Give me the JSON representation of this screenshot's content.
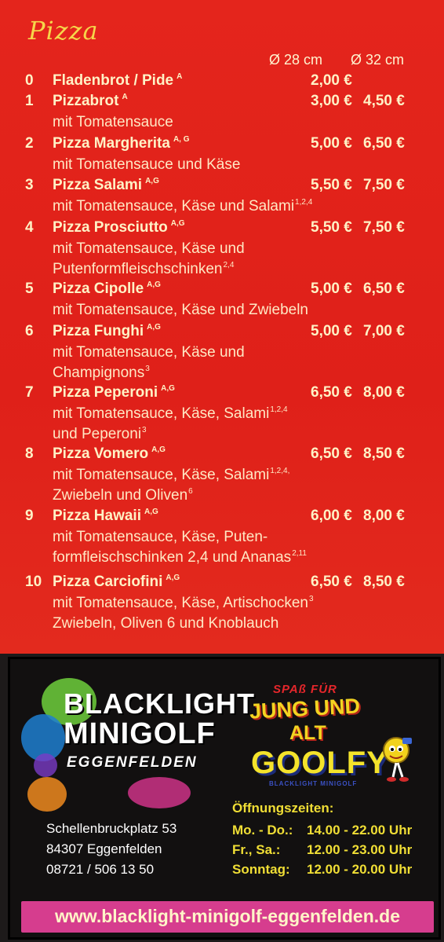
{
  "section_title": "Pizza",
  "sizes": {
    "small": "Ø 28 cm",
    "large": "Ø 32 cm"
  },
  "items": [
    {
      "num": "0",
      "name": "Fladenbrot / Pide",
      "sup": "A",
      "price_28": "2,00 €",
      "price_32": "",
      "desc": []
    },
    {
      "num": "1",
      "name": "Pizzabrot",
      "sup": "A",
      "price_28": "3,00 €",
      "price_32": "4,50 €",
      "desc": [
        {
          "text": "mit Tomatensauce",
          "sup": ""
        }
      ]
    },
    {
      "num": "2",
      "name": "Pizza Margherita",
      "sup": "A, G",
      "price_28": "5,00 €",
      "price_32": "6,50 €",
      "desc": [
        {
          "text": "mit Tomatensauce und Käse",
          "sup": ""
        }
      ]
    },
    {
      "num": "3",
      "name": "Pizza Salami",
      "sup": "A,G",
      "price_28": "5,50 €",
      "price_32": "7,50 €",
      "desc": [
        {
          "text": "mit Tomatensauce, Käse und Salami",
          "sup": "1,2,4"
        }
      ]
    },
    {
      "num": "4",
      "name": "Pizza Prosciutto",
      "sup": "A,G",
      "price_28": "5,50 €",
      "price_32": "7,50 €",
      "desc": [
        {
          "text": "mit Tomatensauce, Käse und",
          "sup": ""
        },
        {
          "text": "Putenformfleischschinken",
          "sup": "2,4"
        }
      ]
    },
    {
      "num": "5",
      "name": "Pizza Cipolle",
      "sup": "A,G",
      "price_28": "5,00 €",
      "price_32": "6,50 €",
      "desc": [
        {
          "text": "mit Tomatensauce, Käse und Zwiebeln",
          "sup": ""
        }
      ]
    },
    {
      "num": "6",
      "name": "Pizza Funghi",
      "sup": "A,G",
      "price_28": "5,00 €",
      "price_32": "7,00 €",
      "desc": [
        {
          "text": "mit Tomatensauce, Käse und",
          "sup": ""
        },
        {
          "text": "Champignons",
          "sup": "3"
        }
      ]
    },
    {
      "num": "7",
      "name": "Pizza Peperoni",
      "sup": "A,G",
      "price_28": "6,50 €",
      "price_32": "8,00 €",
      "desc": [
        {
          "text": "mit Tomatensauce, Käse, Salami",
          "sup": "1,2,4"
        },
        {
          "text": "und Peperoni",
          "sup": "3"
        }
      ]
    },
    {
      "num": "8",
      "name": "Pizza Vomero",
      "sup": "A,G",
      "price_28": "6,50 €",
      "price_32": "8,50 €",
      "desc": [
        {
          "text": "mit Tomatensauce, Käse, Salami",
          "sup": "1,2,4,"
        },
        {
          "text": "Zwiebeln und Oliven",
          "sup": "6"
        }
      ]
    },
    {
      "num": "9",
      "name": "Pizza Hawaii",
      "sup": "A,G",
      "price_28": "6,00 €",
      "price_32": "8,00 €",
      "desc": [
        {
          "text": "mit Tomatensauce, Käse, Puten-",
          "sup": ""
        },
        {
          "text": "formfleischschinken 2,4 und Ananas",
          "sup": "2,11"
        }
      ]
    },
    {
      "num": "10",
      "name": "Pizza Carciofini",
      "sup": "A,G",
      "price_28": "6,50 €",
      "price_32": "8,50 €",
      "desc": [
        {
          "text": "mit Tomatensauce, Käse, Artischocken",
          "sup": "3"
        },
        {
          "text": "Zwiebeln, Oliven 6 und Knoblauch",
          "sup": ""
        }
      ]
    }
  ],
  "ad": {
    "logo_line1": "BLACKLIGHT",
    "logo_line2": "MINIGOLF",
    "logo_line3": "EGGENFELDEN",
    "slogan_1": "SPAß FÜR",
    "slogan_2": "JUNG UND",
    "slogan_3": "ALT",
    "mascot_name": "GOOLFY",
    "mascot_sub": "BLACKLIGHT MINIGOLF",
    "address": [
      "Schellenbruckplatz 53",
      "84307 Eggenfelden",
      "08721 / 506 13 50"
    ],
    "hours_title": "Öffnungszeiten:",
    "hours": [
      {
        "day": "Mo. - Do.:",
        "time": "14.00 - 22.00 Uhr"
      },
      {
        "day": "Fr., Sa.:",
        "time": "12.00 - 23.00 Uhr"
      },
      {
        "day": "Sonntag:",
        "time": "12.00 - 20.00 Uhr"
      }
    ],
    "url": "www.blacklight-minigolf-eggenfelden.de",
    "colors": {
      "menu_bg": "#e2231a",
      "price_text": "#fff2c6",
      "title": "#f6d64a",
      "url_bar": "#d63d8e",
      "hours": "#f0de35"
    }
  }
}
